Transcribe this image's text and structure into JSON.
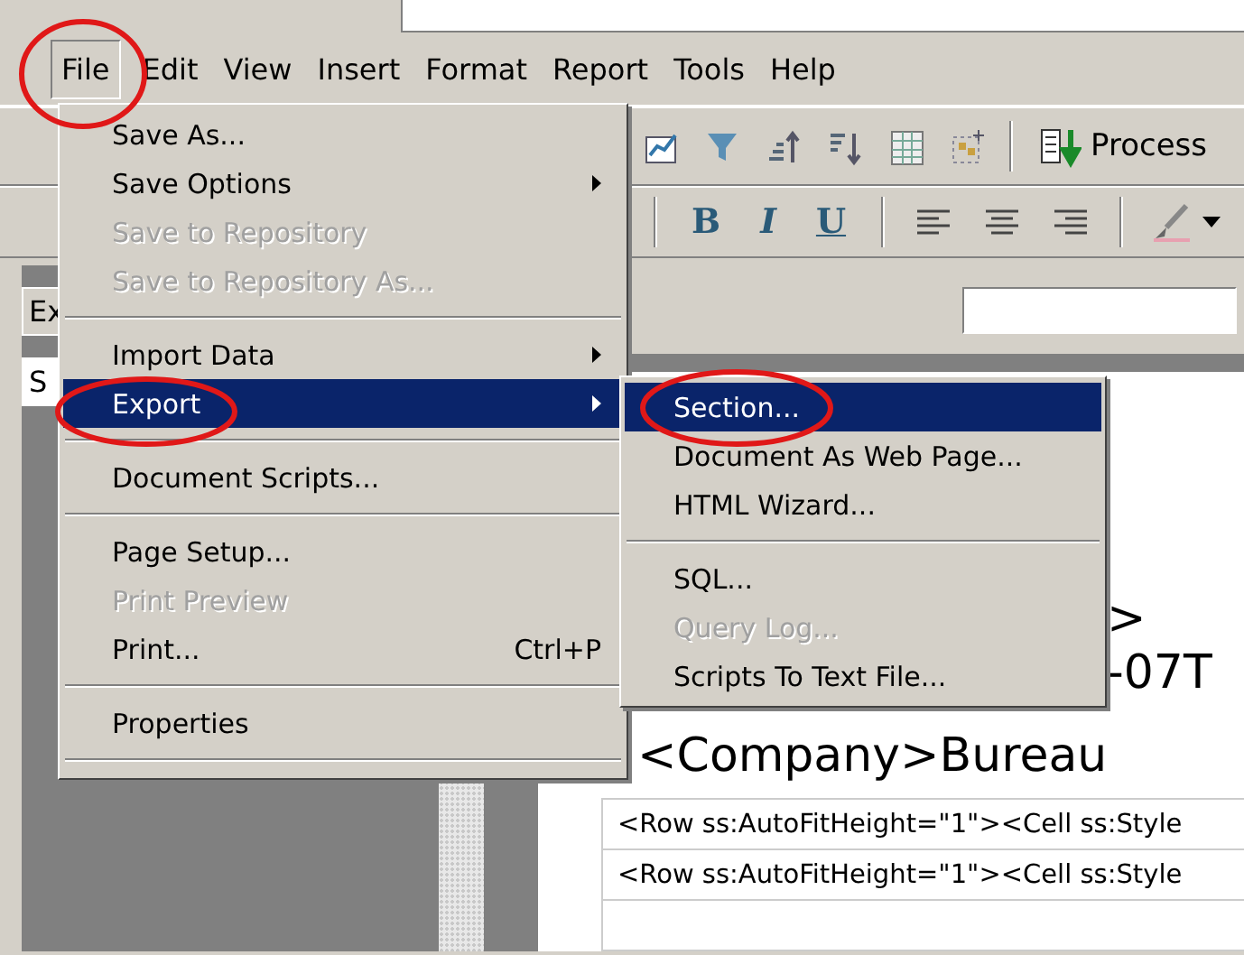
{
  "menubar": [
    {
      "label": "File",
      "selected": true
    },
    {
      "label": "Edit",
      "selected": false
    },
    {
      "label": "View",
      "selected": false
    },
    {
      "label": "Insert",
      "selected": false
    },
    {
      "label": "Format",
      "selected": false
    },
    {
      "label": "Report",
      "selected": false
    },
    {
      "label": "Tools",
      "selected": false
    },
    {
      "label": "Help",
      "selected": false
    }
  ],
  "toolbar": {
    "process_button": "Process",
    "format_buttons": [
      {
        "label": "B",
        "kind": "bold"
      },
      {
        "label": "I",
        "kind": "italic"
      },
      {
        "label": "U",
        "kind": "underline"
      }
    ]
  },
  "side_panel": {
    "tab_fragments": [
      "Ex",
      "S"
    ]
  },
  "document": {
    "heading_fragments": [
      ">",
      "-07T"
    ],
    "company": "<Company>Bureau",
    "rows": [
      "<Row ss:AutoFitHeight=\"1\"><Cell ss:Style",
      "<Row ss:AutoFitHeight=\"1\"><Cell ss:Style"
    ]
  },
  "file_menu": {
    "items": [
      {
        "kind": "item",
        "label": "Save As...",
        "disabled": false,
        "selected": false,
        "has_submenu": false
      },
      {
        "kind": "item",
        "label": "Save Options",
        "disabled": false,
        "selected": false,
        "has_submenu": true
      },
      {
        "kind": "item",
        "label": "Save to Repository",
        "disabled": true,
        "selected": false,
        "has_submenu": false
      },
      {
        "kind": "item",
        "label": "Save to Repository As...",
        "disabled": true,
        "selected": false,
        "has_submenu": false
      },
      {
        "kind": "separator"
      },
      {
        "kind": "item",
        "label": "Import Data",
        "disabled": false,
        "selected": false,
        "has_submenu": true
      },
      {
        "kind": "item",
        "label": "Export",
        "disabled": false,
        "selected": true,
        "has_submenu": true
      },
      {
        "kind": "separator"
      },
      {
        "kind": "item",
        "label": "Document Scripts...",
        "disabled": false,
        "selected": false,
        "has_submenu": false
      },
      {
        "kind": "separator"
      },
      {
        "kind": "item",
        "label": "Page Setup...",
        "disabled": false,
        "selected": false,
        "has_submenu": false
      },
      {
        "kind": "item",
        "label": "Print Preview",
        "disabled": true,
        "selected": false,
        "has_submenu": false
      },
      {
        "kind": "item",
        "label": "Print...",
        "shortcut": "Ctrl+P",
        "disabled": false,
        "selected": false,
        "has_submenu": false
      },
      {
        "kind": "separator"
      },
      {
        "kind": "item",
        "label": "Properties",
        "disabled": false,
        "selected": false,
        "has_submenu": false
      },
      {
        "kind": "separator"
      }
    ]
  },
  "export_submenu": {
    "items": [
      {
        "kind": "item",
        "label": "Section...",
        "disabled": false,
        "selected": true,
        "has_submenu": false
      },
      {
        "kind": "item",
        "label": "Document As Web Page...",
        "disabled": false,
        "selected": false,
        "has_submenu": false
      },
      {
        "kind": "item",
        "label": "HTML Wizard...",
        "disabled": false,
        "selected": false,
        "has_submenu": false
      },
      {
        "kind": "separator"
      },
      {
        "kind": "item",
        "label": "SQL...",
        "disabled": false,
        "selected": false,
        "has_submenu": false
      },
      {
        "kind": "item",
        "label": "Query Log...",
        "disabled": true,
        "selected": false,
        "has_submenu": false
      },
      {
        "kind": "item",
        "label": "Scripts To Text File...",
        "disabled": false,
        "selected": false,
        "has_submenu": false
      }
    ]
  }
}
